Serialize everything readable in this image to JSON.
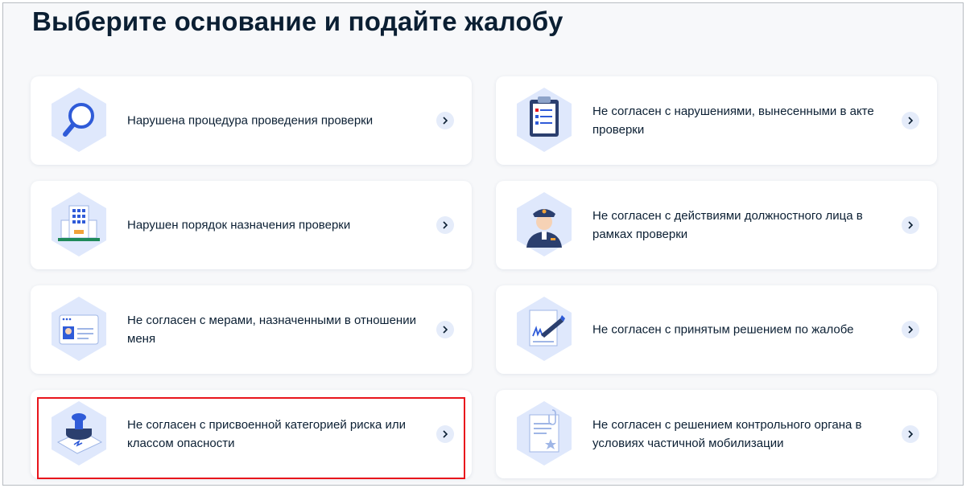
{
  "page": {
    "title": "Выберите основание и подайте жалобу"
  },
  "options": [
    {
      "label": "Нарушена процедура проведения проверки",
      "icon": "magnifier-icon"
    },
    {
      "label": "Не согласен с нарушениями, вынесенными в акте проверки",
      "icon": "clipboard-icon"
    },
    {
      "label": "Нарушен порядок назначения проверки",
      "icon": "building-icon"
    },
    {
      "label": "Не согласен с действиями должностного лица в рамках проверки",
      "icon": "officer-icon"
    },
    {
      "label": "Не согласен с мерами, назначенными в отношении меня",
      "icon": "id-card-icon"
    },
    {
      "label": "Не согласен с принятым решением по жалобе",
      "icon": "signed-document-icon"
    },
    {
      "label": "Не согласен с присвоенной категорией риска или классом опасности",
      "icon": "stamp-icon"
    },
    {
      "label": "Не согласен с решением контрольного органа в условиях частичной мобилизации",
      "icon": "document-star-icon"
    }
  ],
  "colors": {
    "accent_blue": "#2f5bd8",
    "icon_bg": "#dfe8fc",
    "highlight": "#e8151c"
  }
}
